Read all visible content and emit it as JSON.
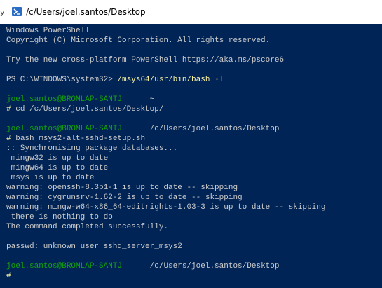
{
  "window": {
    "title": "/c/Users/joel.santos/Desktop",
    "edge_glyph": "y"
  },
  "console": {
    "ps_header_1": "Windows PowerShell",
    "ps_header_2": "Copyright (C) Microsoft Corporation. All rights reserved.",
    "ps_tip": "Try the new cross-platform PowerShell https://aka.ms/pscore6",
    "ps_prompt": "PS C:\\WINDOWS\\system32> ",
    "ps_cmd": "/msys64/usr/bin/bash",
    "ps_cmd_flag": " -l",
    "user_host": "joel.santos@BROMLAP-SANTJ",
    "prompt1_dir": "~",
    "cmd1": "cd /c/Users/joel.santos/Desktop/",
    "prompt2_dir": "/c/Users/joel.santos/Desktop",
    "cmd2": "bash msys2-alt-sshd-setup.sh",
    "out_lines": [
      ":: Synchronising package databases...",
      " mingw32 is up to date",
      " mingw64 is up to date",
      " msys is up to date",
      "warning: openssh-8.3p1-1 is up to date -- skipping",
      "warning: cygrunsrv-1.62-2 is up to date -- skipping",
      "warning: mingw-w64-x86_64-editrights-1.03-3 is up to date -- skipping",
      " there is nothing to do",
      "The command completed successfully."
    ],
    "passwd_line": "passwd: unknown user sshd_server_msys2",
    "prompt3_dir": "/c/Users/joel.santos/Desktop",
    "hash": "#"
  },
  "colors": {
    "background": "#012456",
    "text": "#cccccc",
    "user_host": "#13a10e",
    "command": "#f9f1a5",
    "flag": "#6f6f6f"
  }
}
